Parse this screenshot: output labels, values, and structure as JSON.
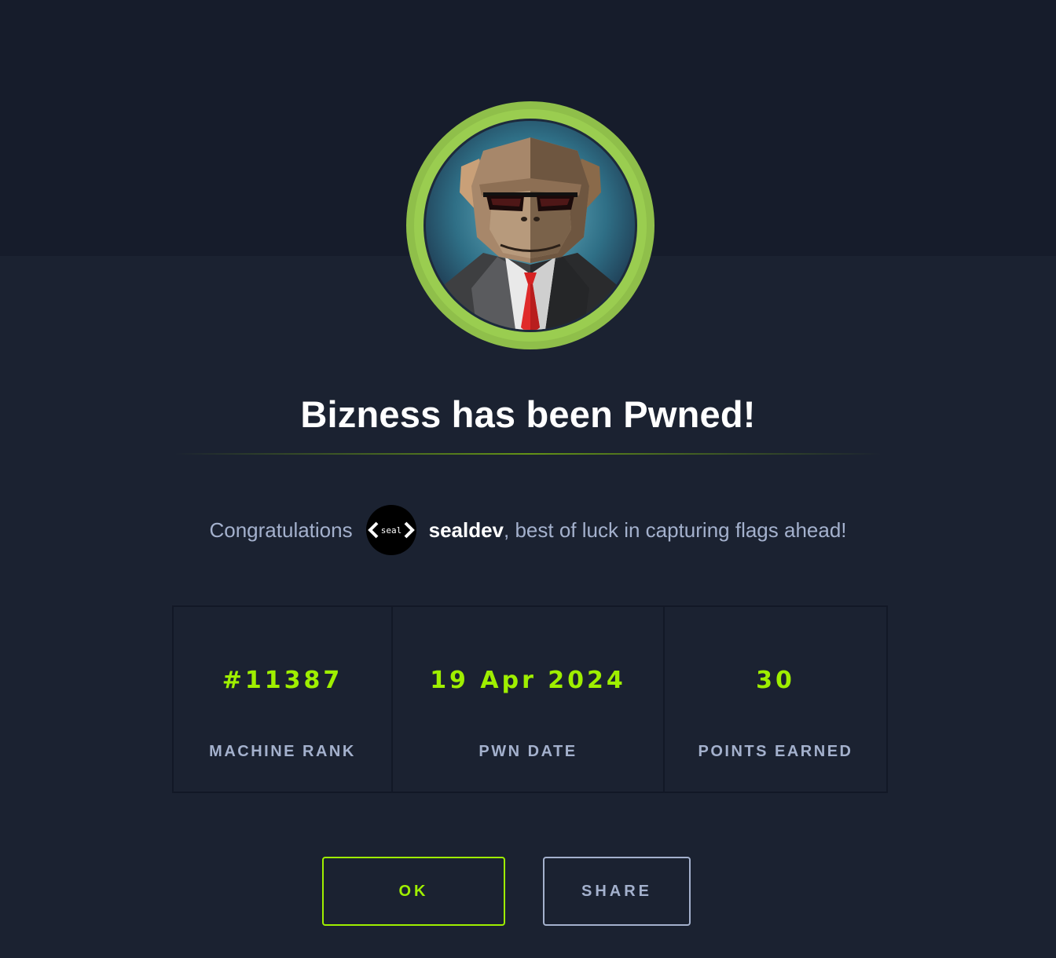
{
  "modal": {
    "title": "Bizness has been Pwned!",
    "avatar_icon": "chimp-in-suit-machine-avatar",
    "congrats": {
      "prefix": "Congratulations",
      "user_avatar_icon": "seal-dev-avatar",
      "user_avatar_text": "seal",
      "username": "sealdev",
      "suffix": ", best of luck in capturing flags ahead!"
    },
    "stats": [
      {
        "value": "#11387",
        "label": "MACHINE RANK"
      },
      {
        "value": "19 Apr 2024",
        "label": "PWN DATE"
      },
      {
        "value": "30",
        "label": "POINTS EARNED"
      }
    ],
    "buttons": {
      "ok_label": "OK",
      "share_label": "SHARE"
    }
  },
  "colors": {
    "accent": "#9fef00",
    "background": "#1b2231",
    "band": "#161c2b",
    "muted_text": "#a4b1cd",
    "avatar_ring": "#9acd50"
  }
}
